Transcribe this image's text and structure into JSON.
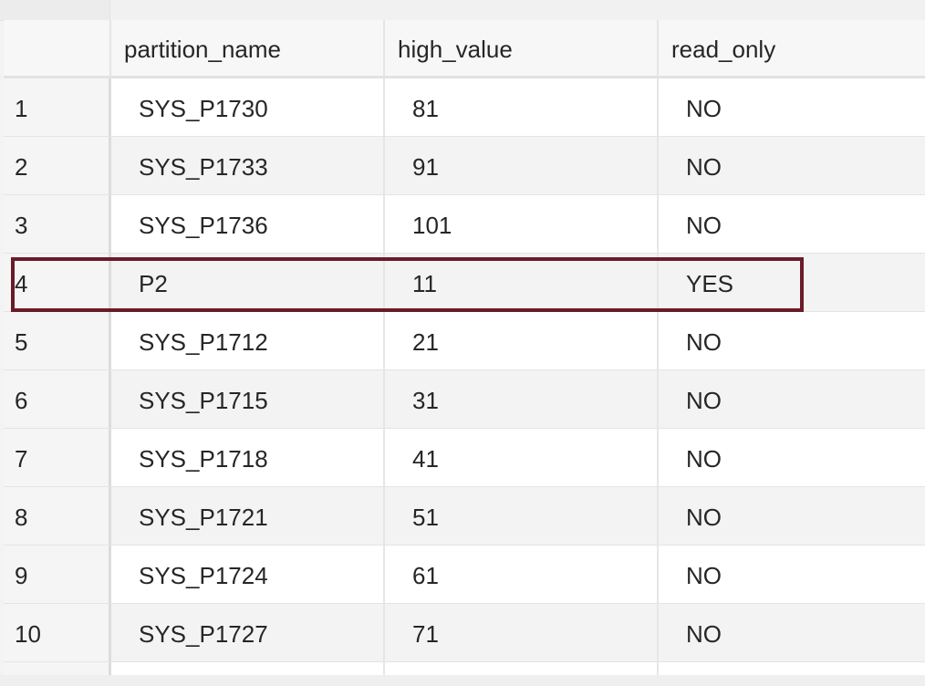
{
  "table": {
    "columns": [
      "partition_name",
      "high_value",
      "read_only"
    ],
    "rows": [
      {
        "num": "1",
        "partition_name": "SYS_P1730",
        "high_value": "81",
        "read_only": "NO"
      },
      {
        "num": "2",
        "partition_name": "SYS_P1733",
        "high_value": "91",
        "read_only": "NO"
      },
      {
        "num": "3",
        "partition_name": "SYS_P1736",
        "high_value": "101",
        "read_only": "NO"
      },
      {
        "num": "4",
        "partition_name": "P2",
        "high_value": "11",
        "read_only": "YES"
      },
      {
        "num": "5",
        "partition_name": "SYS_P1712",
        "high_value": "21",
        "read_only": "NO"
      },
      {
        "num": "6",
        "partition_name": "SYS_P1715",
        "high_value": "31",
        "read_only": "NO"
      },
      {
        "num": "7",
        "partition_name": "SYS_P1718",
        "high_value": "41",
        "read_only": "NO"
      },
      {
        "num": "8",
        "partition_name": "SYS_P1721",
        "high_value": "51",
        "read_only": "NO"
      },
      {
        "num": "9",
        "partition_name": "SYS_P1724",
        "high_value": "61",
        "read_only": "NO"
      },
      {
        "num": "10",
        "partition_name": "SYS_P1727",
        "high_value": "71",
        "read_only": "NO"
      }
    ],
    "highlighted_row": 4
  },
  "colors": {
    "highlight_border": "#6b1a2a",
    "row_even": "#ffffff",
    "row_odd": "#f3f3f3"
  }
}
